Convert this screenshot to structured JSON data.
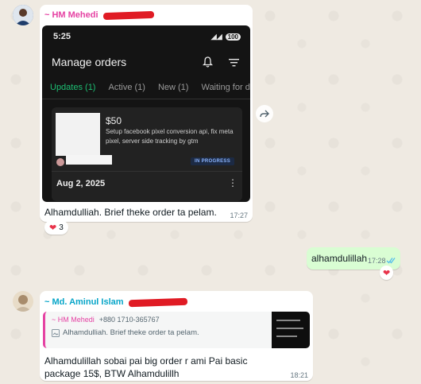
{
  "messages": {
    "first": {
      "sender": "~ HM Mehedi",
      "screenshot": {
        "status_time": "5:25",
        "battery": "100",
        "title": "Manage orders",
        "tabs": [
          "Updates (1)",
          "Active (1)",
          "New (1)",
          "Waiting for det"
        ],
        "order": {
          "price": "$50",
          "description": "Setup facebook pixel conversion api, fix meta pixel, server side tracking by gtm",
          "status": "IN PROGRESS",
          "date": "Aug 2, 2025"
        }
      },
      "text": "Alhamdulliah. Brief theke order ta pelam.",
      "time": "17:27",
      "reaction_count": "3"
    },
    "second": {
      "text": "alhamdulillah",
      "time": "17:28"
    },
    "third": {
      "sender": "~ Md. Aminul Islam",
      "quote": {
        "sender": "~ HM Mehedi",
        "phone": "+880 1710-365767",
        "text": "Alhamdulliah. Brief theke order ta pelam."
      },
      "text": "Alhamdulillah sobai pai big order r ami Pai basic package 15$, BTW Alhamdulillh",
      "time": "18:21"
    }
  },
  "colors": {
    "chat_bg": "#efeae2",
    "outgoing_bubble": "#d9fdd3",
    "accent_green": "#1dbf73",
    "sender_pink": "#e542a3",
    "sender_blue": "#06a5c8"
  }
}
